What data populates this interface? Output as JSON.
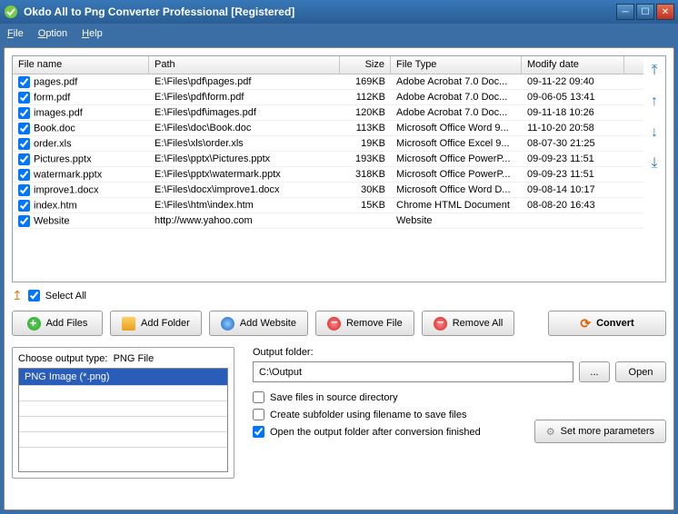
{
  "window": {
    "title": "Okdo All to Png Converter Professional [Registered]"
  },
  "menu": {
    "file": "File",
    "option": "Option",
    "help": "Help"
  },
  "columns": {
    "name": "File name",
    "path": "Path",
    "size": "Size",
    "type": "File Type",
    "date": "Modify date"
  },
  "files": [
    {
      "checked": true,
      "name": "pages.pdf",
      "path": "E:\\Files\\pdf\\pages.pdf",
      "size": "169KB",
      "type": "Adobe Acrobat 7.0 Doc...",
      "date": "09-11-22 09:40"
    },
    {
      "checked": true,
      "name": "form.pdf",
      "path": "E:\\Files\\pdf\\form.pdf",
      "size": "112KB",
      "type": "Adobe Acrobat 7.0 Doc...",
      "date": "09-06-05 13:41"
    },
    {
      "checked": true,
      "name": "images.pdf",
      "path": "E:\\Files\\pdf\\images.pdf",
      "size": "120KB",
      "type": "Adobe Acrobat 7.0 Doc...",
      "date": "09-11-18 10:26"
    },
    {
      "checked": true,
      "name": "Book.doc",
      "path": "E:\\Files\\doc\\Book.doc",
      "size": "113KB",
      "type": "Microsoft Office Word 9...",
      "date": "11-10-20 20:58"
    },
    {
      "checked": true,
      "name": "order.xls",
      "path": "E:\\Files\\xls\\order.xls",
      "size": "19KB",
      "type": "Microsoft Office Excel 9...",
      "date": "08-07-30 21:25"
    },
    {
      "checked": true,
      "name": "Pictures.pptx",
      "path": "E:\\Files\\pptx\\Pictures.pptx",
      "size": "193KB",
      "type": "Microsoft Office PowerP...",
      "date": "09-09-23 11:51"
    },
    {
      "checked": true,
      "name": "watermark.pptx",
      "path": "E:\\Files\\pptx\\watermark.pptx",
      "size": "318KB",
      "type": "Microsoft Office PowerP...",
      "date": "09-09-23 11:51"
    },
    {
      "checked": true,
      "name": "improve1.docx",
      "path": "E:\\Files\\docx\\improve1.docx",
      "size": "30KB",
      "type": "Microsoft Office Word D...",
      "date": "09-08-14 10:17"
    },
    {
      "checked": true,
      "name": "index.htm",
      "path": "E:\\Files\\htm\\index.htm",
      "size": "15KB",
      "type": "Chrome HTML Document",
      "date": "08-08-20 16:43"
    },
    {
      "checked": true,
      "name": "Website",
      "path": "http://www.yahoo.com",
      "size": "",
      "type": "Website",
      "date": ""
    }
  ],
  "selectAll": {
    "label": "Select All",
    "checked": true
  },
  "buttons": {
    "addFiles": "Add Files",
    "addFolder": "Add Folder",
    "addWebsite": "Add Website",
    "removeFile": "Remove File",
    "removeAll": "Remove All",
    "convert": "Convert"
  },
  "outputType": {
    "label": "Choose output type:",
    "current": "PNG File",
    "listItem": "PNG Image (*.png)"
  },
  "outputFolder": {
    "label": "Output folder:",
    "value": "C:\\Output",
    "browse": "...",
    "open": "Open"
  },
  "options": {
    "saveSource": {
      "label": "Save files in source directory",
      "checked": false
    },
    "createSub": {
      "label": "Create subfolder using filename to save files",
      "checked": false
    },
    "openAfter": {
      "label": "Open the output folder after conversion finished",
      "checked": true
    }
  },
  "setMore": "Set more parameters"
}
